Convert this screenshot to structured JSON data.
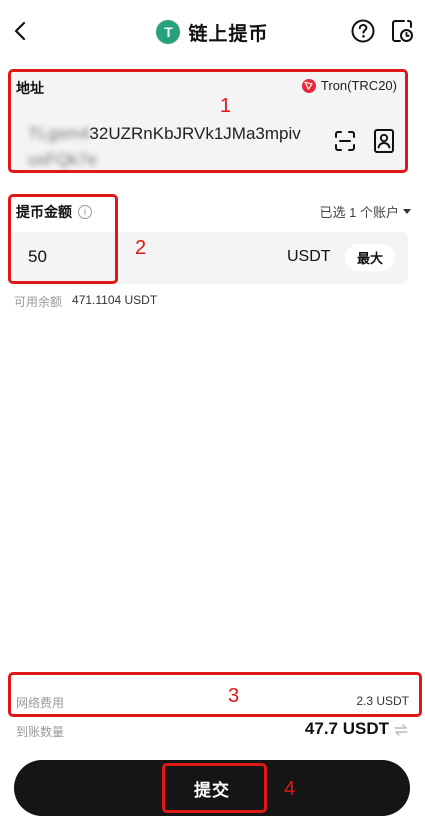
{
  "header": {
    "title": "链上提币",
    "token_symbol_glyph": "T"
  },
  "address": {
    "label": "地址",
    "network": "Tron(TRC20)",
    "value_visible": "32UZRnKbJRVk1JMa3mpiv",
    "value_blurred_prefix": "TLgsm4",
    "value_blurred_suffix": "uxFQk7e"
  },
  "amount": {
    "label": "提币金额",
    "info_glyph": "i",
    "account_select": "已选 1 个账户",
    "value": "50",
    "unit": "USDT",
    "max_label": "最大",
    "available_label": "可用余额",
    "available_value": "471.1104 USDT"
  },
  "fees": {
    "network_fee_label": "网络费用",
    "network_fee_value": "2.3 USDT",
    "receive_label": "到账数量",
    "receive_value": "47.7 USDT"
  },
  "submit": {
    "label": "提交"
  },
  "annotations": [
    "1",
    "2",
    "3",
    "4"
  ],
  "colors": {
    "accent_red": "#e01717",
    "usdt_green": "#26a17b",
    "tron_red": "#e8283a",
    "button_black": "#151515"
  }
}
